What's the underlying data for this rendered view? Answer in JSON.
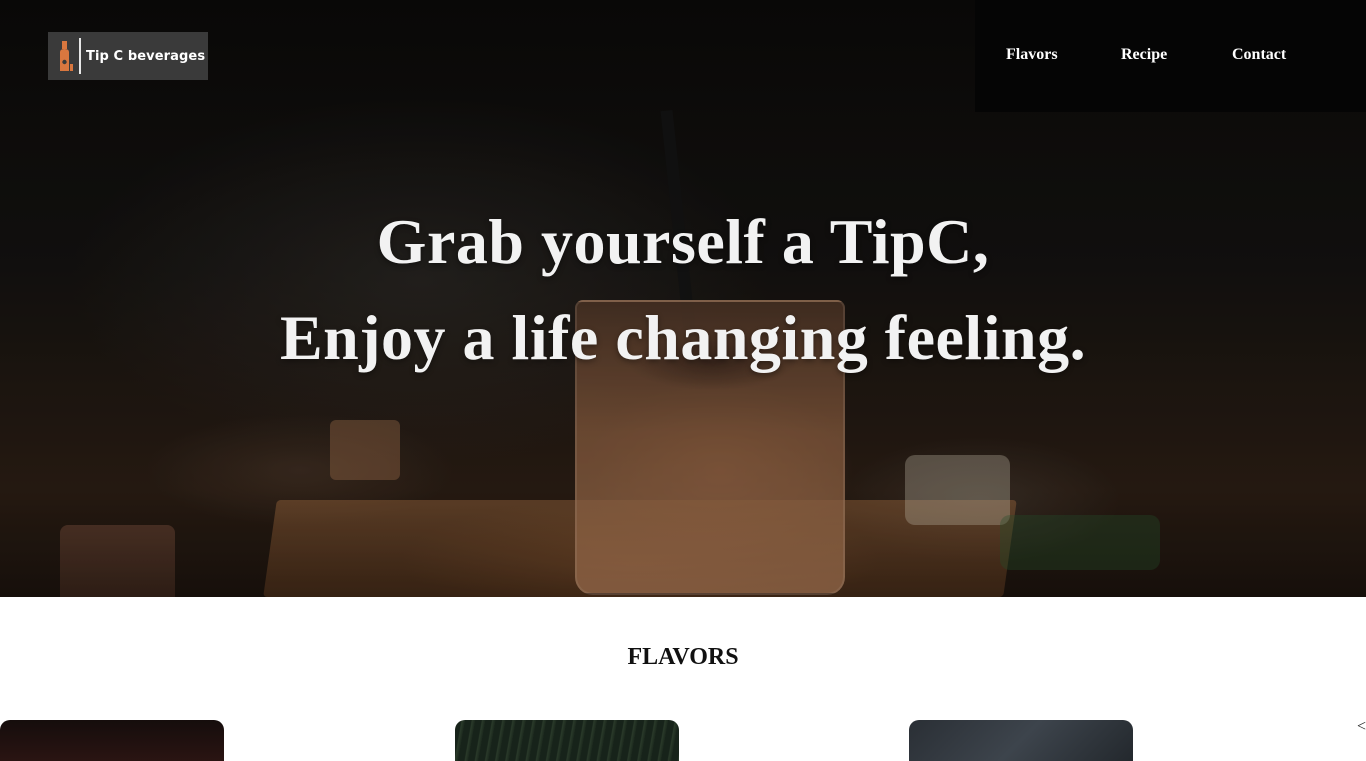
{
  "brand": {
    "name": "Tip C beverages",
    "logo_icon": "bottle-icon"
  },
  "nav": {
    "items": [
      {
        "label": "Flavors"
      },
      {
        "label": "Recipe"
      },
      {
        "label": "Contact"
      }
    ]
  },
  "hero": {
    "line1": "Grab yourself a TipC,",
    "line2": "Enjoy a life changing feeling."
  },
  "flavors": {
    "title": "FLAVORS",
    "carousel_prev_icon": "chevron-left-icon",
    "carousel_prev_glyph": "<"
  }
}
